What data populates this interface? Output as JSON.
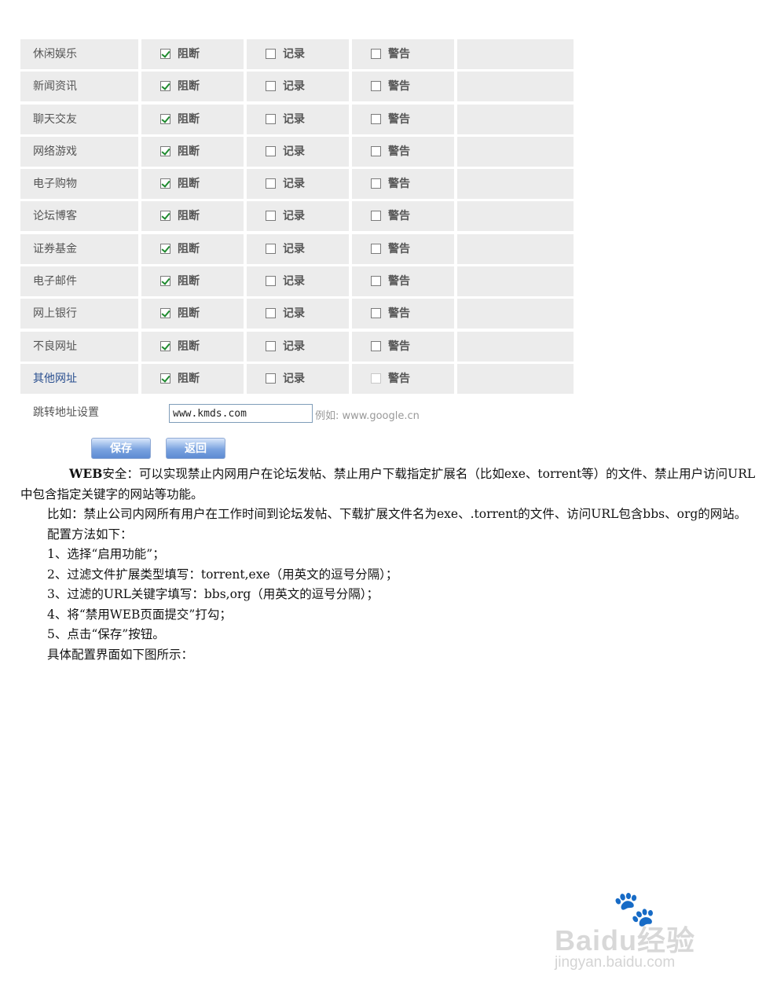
{
  "options": {
    "block": "阻断",
    "log": "记录",
    "alert": "警告"
  },
  "rows": [
    {
      "name": "休闲娱乐",
      "block": true,
      "log": false,
      "alert": false
    },
    {
      "name": "新闻资讯",
      "block": true,
      "log": false,
      "alert": false
    },
    {
      "name": "聊天交友",
      "block": true,
      "log": false,
      "alert": false
    },
    {
      "name": "网络游戏",
      "block": true,
      "log": false,
      "alert": false
    },
    {
      "name": "电子购物",
      "block": true,
      "log": false,
      "alert": false
    },
    {
      "name": "论坛博客",
      "block": true,
      "log": false,
      "alert": false
    },
    {
      "name": "证券基金",
      "block": true,
      "log": false,
      "alert": false
    },
    {
      "name": "电子邮件",
      "block": true,
      "log": false,
      "alert": false
    },
    {
      "name": "网上银行",
      "block": true,
      "log": false,
      "alert": false
    },
    {
      "name": "不良网址",
      "block": true,
      "log": false,
      "alert": false
    },
    {
      "name": "其他网址",
      "block": true,
      "log": false,
      "alert": false
    }
  ],
  "redirect": {
    "label": "跳转地址设置",
    "value": "www.kmds.com",
    "hint": "例如: www.google.cn"
  },
  "buttons": {
    "save": "保存",
    "back": "返回"
  },
  "article": {
    "p1_lead": "WEB",
    "p1_rest": "安全：可以实现禁止内网用户在论坛发帖、禁止用户下载指定扩展名（比如exe、torrent等）的文件、禁止用户访问URL中包含指定关键字的网站等功能。",
    "p2": "比如：禁止公司内网所有用户在工作时间到论坛发帖、下载扩展文件名为exe、.torrent的文件、访问URL包含bbs、org的网站。配置方法如下：",
    "steps": [
      "1、选择“启用功能”；",
      "2、过滤文件扩展类型填写：torrent,exe（用英文的逗号分隔）；",
      "3、过滤的URL关键字填写：bbs,org（用英文的逗号分隔）；",
      "4、将“禁用WEB页面提交”打勾；",
      "5、点击“保存”按钮。"
    ],
    "outro": "具体配置界面如下图所示："
  },
  "watermark": {
    "logo": "Baidu经验",
    "url": "jingyan.baidu.com"
  }
}
